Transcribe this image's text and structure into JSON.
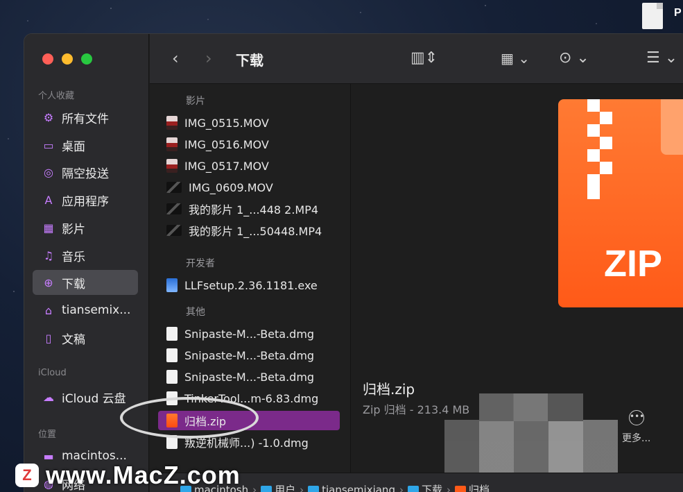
{
  "desktop": {
    "file_label": "P"
  },
  "sidebar": {
    "section_favorites": "个人收藏",
    "items": [
      {
        "label": "所有文件",
        "icon": "recents-icon"
      },
      {
        "label": "桌面",
        "icon": "desktop-icon"
      },
      {
        "label": "隔空投送",
        "icon": "airdrop-icon"
      },
      {
        "label": "应用程序",
        "icon": "applications-icon"
      },
      {
        "label": "影片",
        "icon": "movies-icon"
      },
      {
        "label": "音乐",
        "icon": "music-icon"
      },
      {
        "label": "下载",
        "icon": "downloads-icon"
      },
      {
        "label": "tiansemix...",
        "icon": "home-icon"
      },
      {
        "label": "文稿",
        "icon": "documents-icon"
      }
    ],
    "section_icloud": "iCloud",
    "icloud_item": {
      "label": "iCloud 云盘",
      "icon": "cloud-icon"
    },
    "section_locations": "位置",
    "location_items": [
      {
        "label": "macintos...",
        "icon": "disk-icon"
      },
      {
        "label": "网络",
        "icon": "network-icon"
      }
    ]
  },
  "toolbar": {
    "title": "下载",
    "back": "‹",
    "forward": "›"
  },
  "filelist": {
    "groups": [
      {
        "title": "影片"
      },
      {
        "title": "开发者"
      },
      {
        "title": "其他"
      }
    ],
    "movies": [
      "IMG_0515.MOV",
      "IMG_0516.MOV",
      "IMG_0517.MOV",
      "IMG_0609.MOV",
      "我的影片 1_...448 2.MP4",
      "我的影片 1_...50448.MP4"
    ],
    "developer": [
      "LLFsetup.2.36.1181.exe"
    ],
    "other": [
      "Snipaste-M...-Beta.dmg",
      "Snipaste-M...-Beta.dmg",
      "Snipaste-M...-Beta.dmg",
      "TinkerTool...m-6.83.dmg",
      "归档.zip",
      "叛逆机械师...) -1.0.dmg"
    ]
  },
  "preview": {
    "icon_text": "ZIP",
    "name": "归档.zip",
    "meta": "Zip 归档 - 213.4 MB",
    "more_label": "更多..."
  },
  "pathbar": {
    "items": [
      "macintosh",
      "用户",
      "tiansemixiang",
      "下载",
      "归档"
    ]
  },
  "watermark": {
    "logo": "Z",
    "text": "www.MacZ.com"
  }
}
